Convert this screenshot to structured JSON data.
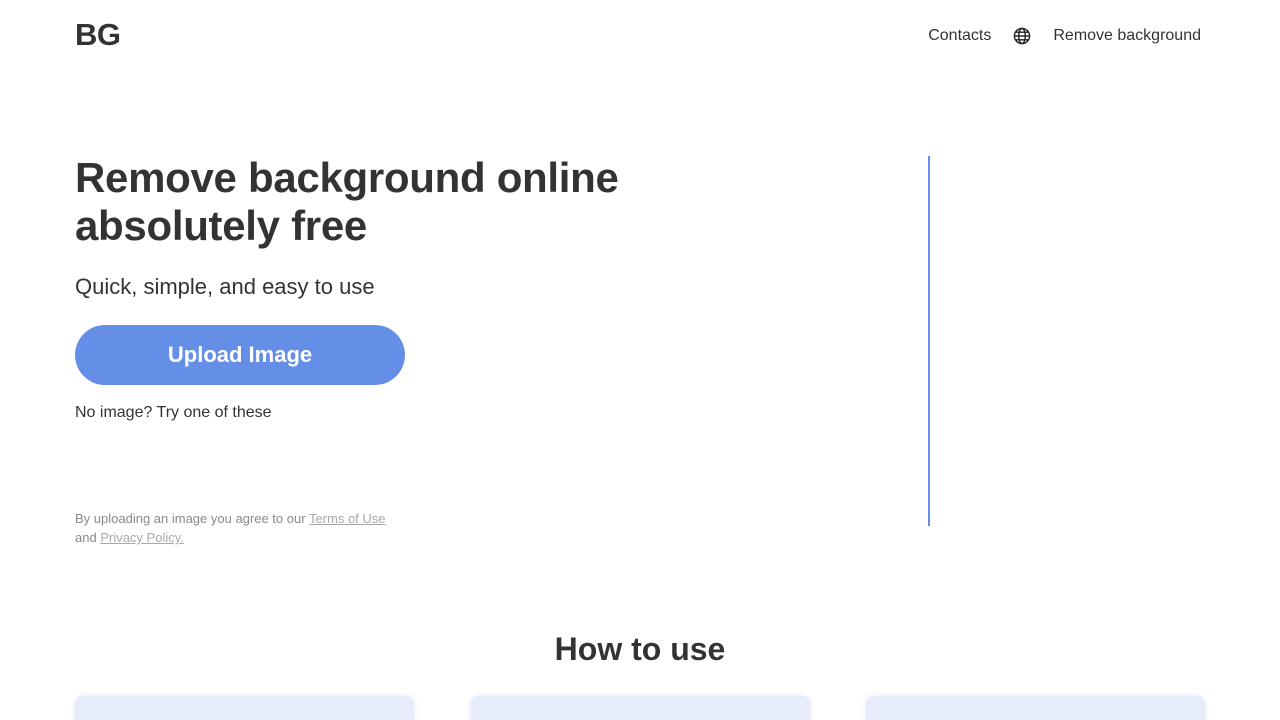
{
  "header": {
    "logo": "BG",
    "nav": {
      "contacts": "Contacts",
      "language_icon": "globe-icon",
      "remove_background": "Remove background"
    }
  },
  "hero": {
    "title": "Remove background online absolutely free",
    "subtitle": "Quick, simple, and easy to use",
    "upload_button": "Upload Image",
    "try_text": "No image? Try one of these",
    "legal": {
      "prefix": "By uploading an image you agree to our ",
      "terms_link": "Terms of Use",
      "and": "and ",
      "privacy_link": "Privacy Policy."
    }
  },
  "how_to_use": {
    "title": "How to use"
  },
  "colors": {
    "accent": "#658fe6",
    "text": "#333333",
    "card_bg": "#e6ecfb",
    "muted": "#8a8a8a"
  }
}
